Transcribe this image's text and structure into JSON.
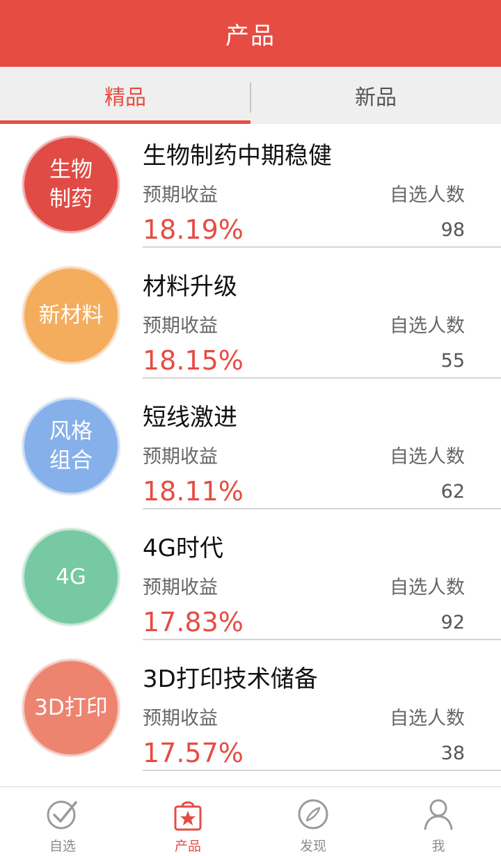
{
  "header": {
    "title": "产品"
  },
  "tabs": [
    {
      "label": "精品",
      "active": true
    },
    {
      "label": "新品",
      "active": false
    }
  ],
  "labels": {
    "yield": "预期收益",
    "followers": "自选人数"
  },
  "products": [
    {
      "badge": "生物\n制药",
      "badge_color": "#e04b45",
      "name": "生物制药中期稳健",
      "yield": "18.19%",
      "followers": "98"
    },
    {
      "badge": "新材料",
      "badge_color": "#f4ad5c",
      "name": "材料升级",
      "yield": "18.15%",
      "followers": "55"
    },
    {
      "badge": "风格\n组合",
      "badge_color": "#86b0ea",
      "name": "短线激进",
      "yield": "18.11%",
      "followers": "62"
    },
    {
      "badge": "4G",
      "badge_color": "#76c9a2",
      "name": "4G时代",
      "yield": "17.83%",
      "followers": "92"
    },
    {
      "badge": "3D打印",
      "badge_color": "#ec8470",
      "name": "3D打印技术储备",
      "yield": "17.57%",
      "followers": "38"
    }
  ],
  "bottom_nav": [
    {
      "label": "自选",
      "icon": "check-circle-icon",
      "active": false
    },
    {
      "label": "产品",
      "icon": "shopping-bag-star-icon",
      "active": true
    },
    {
      "label": "发现",
      "icon": "compass-icon",
      "active": false
    },
    {
      "label": "我",
      "icon": "person-icon",
      "active": false
    }
  ],
  "colors": {
    "accent": "#e64c42"
  }
}
